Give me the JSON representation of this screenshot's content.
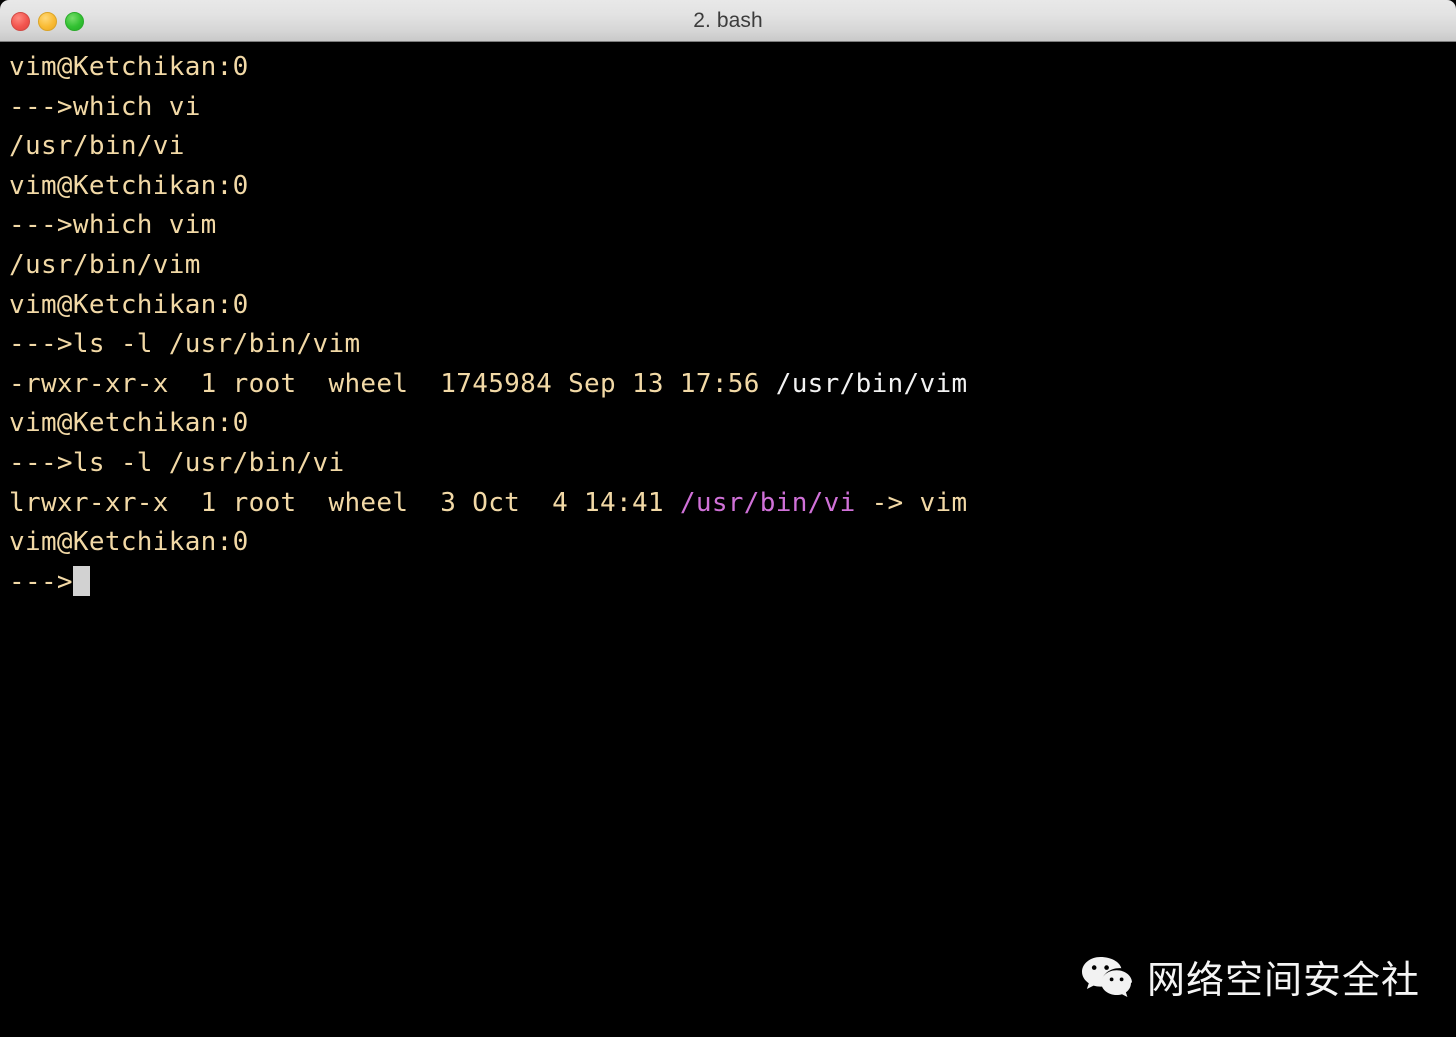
{
  "window": {
    "title": "2. bash",
    "controls": [
      {
        "name": "close",
        "label": "Close"
      },
      {
        "name": "minimize",
        "label": "Minimize"
      },
      {
        "name": "zoom",
        "label": "Zoom"
      }
    ]
  },
  "terminal": {
    "background": "#000000",
    "foreground": "#f2d9a6",
    "cursor_color": "#d2d2d2",
    "colors": {
      "prompt": "#f2d9a6",
      "default": "#f2d9a6",
      "white": "#f2f2f2",
      "symlink": "#d071d8"
    },
    "lines": [
      {
        "segments": [
          {
            "text": "vim@Ketchikan:0",
            "color": "prompt"
          }
        ]
      },
      {
        "segments": [
          {
            "text": "--->which vi",
            "color": "prompt"
          }
        ]
      },
      {
        "segments": [
          {
            "text": "/usr/bin/vi",
            "color": "default"
          }
        ]
      },
      {
        "segments": [
          {
            "text": "vim@Ketchikan:0",
            "color": "prompt"
          }
        ]
      },
      {
        "segments": [
          {
            "text": "--->which vim",
            "color": "prompt"
          }
        ]
      },
      {
        "segments": [
          {
            "text": "/usr/bin/vim",
            "color": "default"
          }
        ]
      },
      {
        "segments": [
          {
            "text": "vim@Ketchikan:0",
            "color": "prompt"
          }
        ]
      },
      {
        "segments": [
          {
            "text": "--->ls -l /usr/bin/vim",
            "color": "prompt"
          }
        ]
      },
      {
        "segments": [
          {
            "text": "-rwxr-xr-x  1 root  wheel  1745984 Sep 13 17:56 ",
            "color": "default"
          },
          {
            "text": "/usr/bin/vim",
            "color": "white"
          }
        ]
      },
      {
        "segments": [
          {
            "text": "vim@Ketchikan:0",
            "color": "prompt"
          }
        ]
      },
      {
        "segments": [
          {
            "text": "--->ls -l /usr/bin/vi",
            "color": "prompt"
          }
        ]
      },
      {
        "segments": [
          {
            "text": "lrwxr-xr-x  1 root  wheel  3 Oct  4 14:41 ",
            "color": "default"
          },
          {
            "text": "/usr/bin/vi",
            "color": "symlink"
          },
          {
            "text": " -> vim",
            "color": "default"
          }
        ]
      },
      {
        "segments": [
          {
            "text": "vim@Ketchikan:0",
            "color": "prompt"
          }
        ]
      },
      {
        "segments": [
          {
            "text": "--->",
            "color": "prompt"
          }
        ],
        "cursor": true
      }
    ]
  },
  "watermark": {
    "icon": "wechat-icon",
    "text": "网络空间安全社"
  }
}
